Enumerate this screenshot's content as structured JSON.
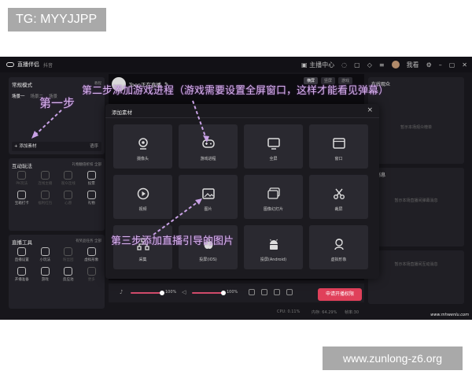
{
  "watermarks": {
    "top": "TG: MYYJJPP",
    "bottom": "www.zunlong-z6.org",
    "site": "www.mhwenlu.com"
  },
  "titlebar": {
    "app_name": "直播伴侣",
    "subtitle": "抖音",
    "live_center": "主播中心",
    "nickname": "我看"
  },
  "left": {
    "mode_title": "常规模式",
    "mode_note": "教程",
    "scene_tabs": [
      "场景一",
      "场景二",
      "场景"
    ],
    "add_material": "添加素材",
    "add_material_right": "语序",
    "interactive": {
      "title": "互动玩法",
      "note": "礼物翻倍折扣 全部",
      "tools": [
        {
          "label": "PK玩法",
          "dim": true
        },
        {
          "label": "连线主播",
          "dim": true
        },
        {
          "label": "观众连线",
          "dim": true
        },
        {
          "label": "投票",
          "dim": false
        },
        {
          "label": "宝箱打卡",
          "dim": false
        },
        {
          "label": "福利红包",
          "dim": true
        },
        {
          "label": "心愿",
          "dim": true
        },
        {
          "label": "礼物",
          "dim": false
        }
      ]
    },
    "live_tools": {
      "title": "直播工具",
      "note": "有奖品任务 全部",
      "tools": [
        {
          "label": "直播设置",
          "dim": false
        },
        {
          "label": "小玩法",
          "dim": false
        },
        {
          "label": "粉丝团",
          "dim": true
        },
        {
          "label": "虚拟形象",
          "dim": false
        },
        {
          "label": "开播准备",
          "dim": false
        },
        {
          "label": "游戏",
          "dim": false
        },
        {
          "label": "反应池",
          "dim": false
        },
        {
          "label": "更多",
          "dim": true
        }
      ]
    }
  },
  "preview": {
    "streamer": "Toen正在直播",
    "modes": [
      "横屏",
      "竖屏",
      "游戏"
    ],
    "volume_1": "100%",
    "volume_2": "100%",
    "go_live": "申请开播权限"
  },
  "right": {
    "top_title": "在线观众",
    "top_hint": "暂示本场观众榜单",
    "mid_title": "弹消息",
    "mid_hint": "暂示本场直播间弹幕消息",
    "bottom_hint": "暂示本场直播间互动消息"
  },
  "status": {
    "cpu": "CPU: 0.11%",
    "memory": "内存: 64.29%",
    "frames": "帧率:30"
  },
  "modal": {
    "title": "添加素材",
    "close": "×",
    "items": [
      {
        "label": "摄像头",
        "icon": "camera-icon"
      },
      {
        "label": "游戏进程",
        "icon": "gamepad-icon"
      },
      {
        "label": "全屏",
        "icon": "monitor-icon"
      },
      {
        "label": "窗口",
        "icon": "window-icon"
      },
      {
        "label": "视频",
        "icon": "play-icon"
      },
      {
        "label": "图片",
        "icon": "image-icon"
      },
      {
        "label": "图像幻灯片",
        "icon": "slides-icon"
      },
      {
        "label": "裁屏",
        "icon": "scissors-icon"
      },
      {
        "label": "采集",
        "icon": "capture-icon"
      },
      {
        "label": "投屏(iOS)",
        "icon": "apple-icon"
      },
      {
        "label": "投屏(Android)",
        "icon": "android-icon"
      },
      {
        "label": "虚拟形象",
        "icon": "avatar-icon"
      }
    ]
  },
  "annotations": {
    "step1": "第一步",
    "step2": "第二步添加游戏进程（游戏需要设置全屏窗口，这样才能看见弹幕）",
    "step3": "第三步添加直播引导的图片"
  }
}
